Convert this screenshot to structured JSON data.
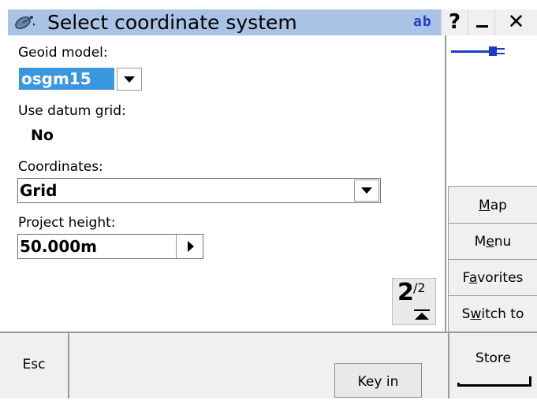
{
  "window": {
    "title": "Select coordinate system",
    "input_mode": "ab",
    "help_label": "?",
    "minimize_label": "_",
    "close_label": "✕",
    "logo_icon": "satellite-dish-icon"
  },
  "form": {
    "geoid_label": "Geoid model:",
    "geoid_value": "osgm15",
    "datum_label": "Use datum grid:",
    "datum_value": "No",
    "coords_label": "Coordinates:",
    "coords_value": "Grid",
    "height_label": "Project height:",
    "height_value": "50.000m"
  },
  "page": {
    "current": "2",
    "total": "/2"
  },
  "status": {
    "power_icon": "power-plug-icon"
  },
  "side_buttons": [
    {
      "label": "Map",
      "mnemonic": "M"
    },
    {
      "label": "Menu",
      "mnemonic": "e"
    },
    {
      "label": "Favorites",
      "mnemonic": "a"
    },
    {
      "label": "Switch to",
      "mnemonic": "w"
    }
  ],
  "softkeys": {
    "esc": "Esc",
    "key_in": "Key in",
    "store": "Store"
  },
  "colors": {
    "titlebar": "#a9c3e6",
    "selection": "#3a96dd",
    "indicator": "#2340c8",
    "power": "#1a3cc8"
  }
}
